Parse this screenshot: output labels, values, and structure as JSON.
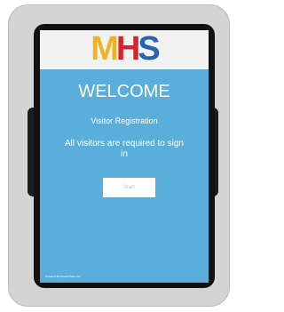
{
  "logo": {
    "letters": [
      "M",
      "H",
      "S"
    ],
    "colors": [
      "#f0b323",
      "#d8232a",
      "#2a63b0"
    ]
  },
  "screen": {
    "heading": "WELCOME",
    "subtitle": "Visitor Registration",
    "message": "All visitors are required to sign in",
    "start_label": "Start",
    "footer": "Powered By eVisitorPass.com",
    "background_color": "#5aaedc"
  }
}
